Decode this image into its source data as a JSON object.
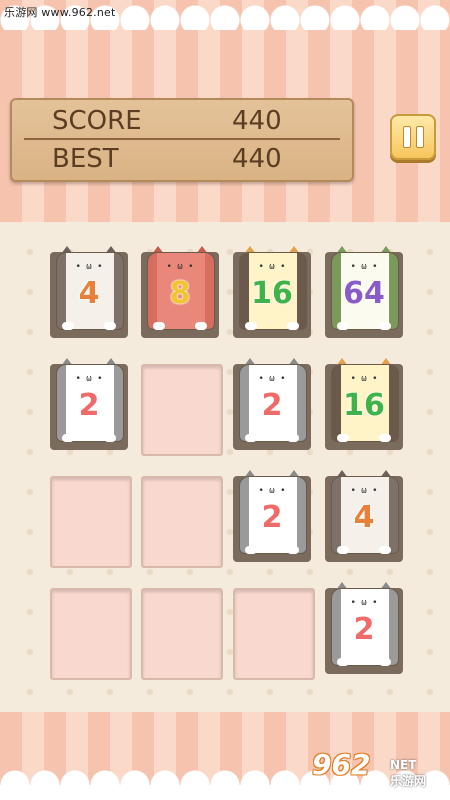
{
  "watermark": {
    "top_text": "乐游网 www.962.net",
    "logo_text": "962",
    "logo_sub": "NET",
    "logo_cn": "乐游网"
  },
  "scoreboard": {
    "score_label": "SCORE",
    "score_value": "440",
    "best_label": "BEST",
    "best_value": "440"
  },
  "pause_button": {
    "icon": "pause-icon"
  },
  "board": {
    "rows": 4,
    "cols": 4,
    "tiles": [
      [
        {
          "value": "4",
          "cat": "tabby-gray",
          "color": "#e8803a"
        },
        {
          "value": "8",
          "cat": "orange-red",
          "color": "#f0c630"
        },
        {
          "value": "16",
          "cat": "calico",
          "color": "#3fb24a"
        },
        {
          "value": "64",
          "cat": "green-spotted",
          "color": "#8a5cc8"
        }
      ],
      [
        {
          "value": "2",
          "cat": "gray-white",
          "color": "#f06a6a"
        },
        null,
        {
          "value": "2",
          "cat": "gray-white",
          "color": "#f06a6a"
        },
        {
          "value": "16",
          "cat": "calico",
          "color": "#3fb24a"
        }
      ],
      [
        null,
        null,
        {
          "value": "2",
          "cat": "gray-white",
          "color": "#f06a6a"
        },
        {
          "value": "4",
          "cat": "tabby-gray",
          "color": "#e8803a"
        }
      ],
      [
        null,
        null,
        null,
        {
          "value": "2",
          "cat": "gray-white",
          "color": "#f06a6a"
        }
      ]
    ]
  },
  "colors": {
    "stripe_light": "#fbd9c9",
    "stripe_dark": "#f6c4ae",
    "cell_empty": "#f8d8cf",
    "wood_panel": "#d9b384"
  }
}
